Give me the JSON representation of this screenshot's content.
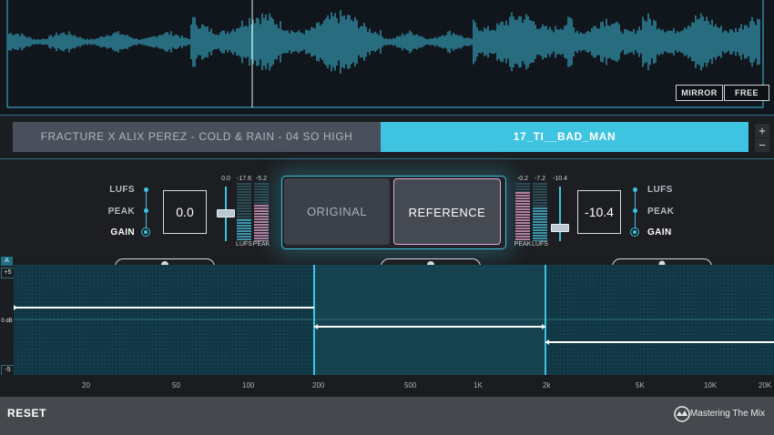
{
  "waveform": {
    "mirror_label": "MIRROR",
    "free_label": "FREE"
  },
  "tracks": {
    "original_name": "FRACTURE X ALIX PEREZ - COLD & RAIN - 04 SO HIGH",
    "reference_name": "17_TI__BAD_MAN",
    "add_label": "+",
    "remove_label": "−"
  },
  "left_panel": {
    "modes": [
      "LUFS",
      "PEAK",
      "GAIN"
    ],
    "active_mode": "GAIN",
    "gain_value": "0.0",
    "slider_value": "0.0",
    "meter_values": [
      "-17.6",
      "-5.2"
    ],
    "meter_labels": [
      "LUFS",
      "PEAK"
    ]
  },
  "ab_switch": {
    "original_label": "ORIGINAL",
    "reference_label": "REFERENCE",
    "selected": "REFERENCE"
  },
  "right_panel": {
    "modes": [
      "LUFS",
      "PEAK",
      "GAIN"
    ],
    "active_mode": "GAIN",
    "gain_value": "-10.4",
    "slider_value": "-10.4",
    "meter_values": [
      "-0.2",
      "-7.2"
    ],
    "meter_labels": [
      "PEAK",
      "LUFS"
    ]
  },
  "eq": {
    "badge_a": "A",
    "top_label": "+5",
    "mid_label": "0 dB",
    "bottom_label": "-5",
    "freq_ticks": [
      "20",
      "50",
      "100",
      "200",
      "500",
      "1K",
      "2k",
      "5K",
      "10K",
      "20K"
    ]
  },
  "footer": {
    "reset_label": "RESET",
    "brand": "Mastering The Mix"
  },
  "colors": {
    "accent": "#3ec3e0",
    "waveform_bg": "#10161c",
    "eq_bg": "#113744",
    "original_track_bg": "#4a4f5c",
    "reference_highlight": "#e6a6d8"
  }
}
